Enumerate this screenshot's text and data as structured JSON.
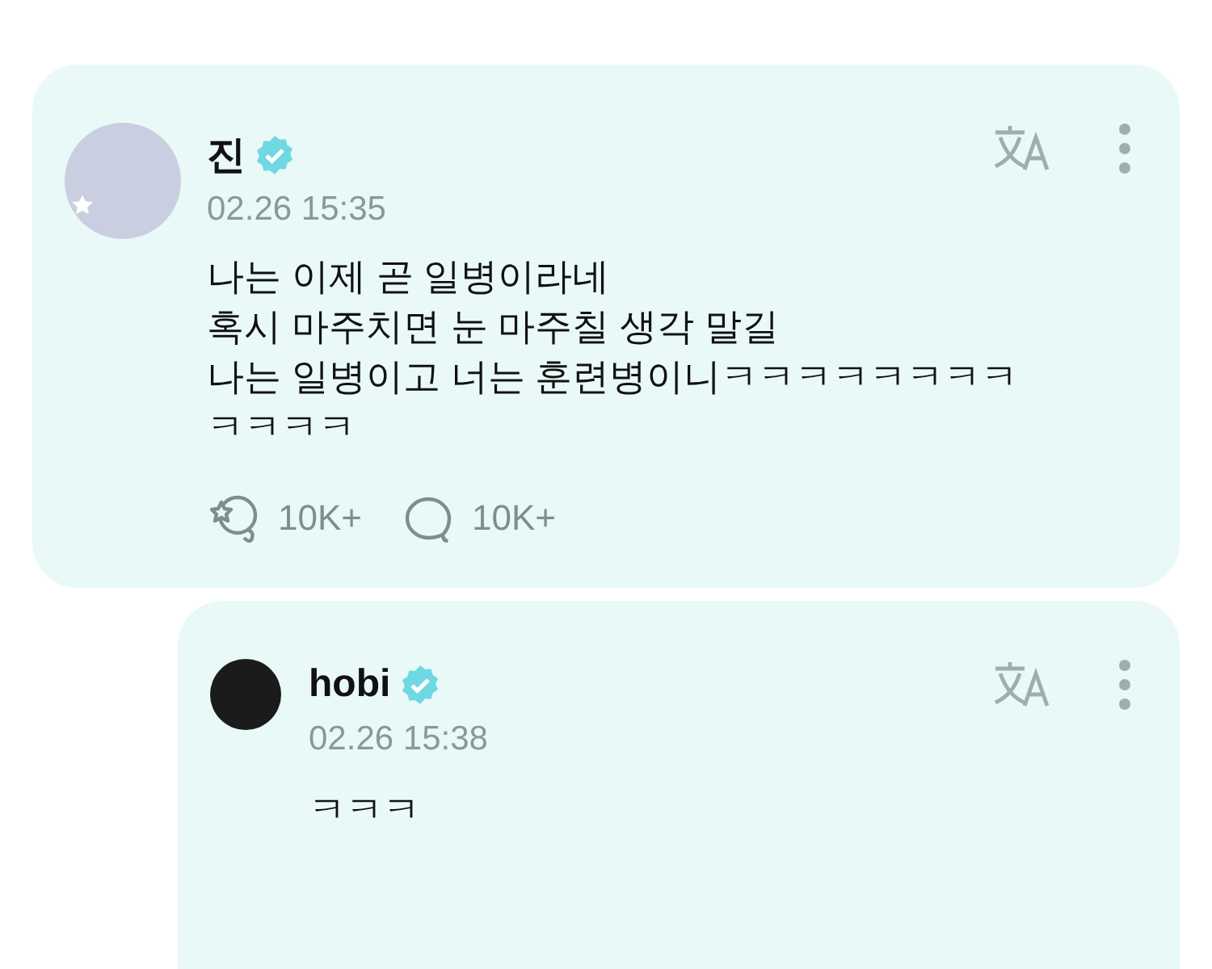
{
  "posts": [
    {
      "kind": "post",
      "author": "진",
      "time": "02.26 15:35",
      "avatar_badge": true,
      "verified": true,
      "lines": [
        "나는 이제 곧 일병이라네",
        "혹시 마주치면 눈 마주칠 생각 말길",
        "나는 일병이고 너는 훈련병이니ㅋㅋㅋㅋㅋㅋㅋㅋ",
        "ㅋㅋㅋㅋ"
      ],
      "reactions": "10K+",
      "comments": "10K+"
    },
    {
      "kind": "reply",
      "author": "hobi",
      "time": "02.26 15:38",
      "avatar_badge": false,
      "verified": true,
      "lines": [
        "ㅋㅋㅋ"
      ]
    }
  ]
}
